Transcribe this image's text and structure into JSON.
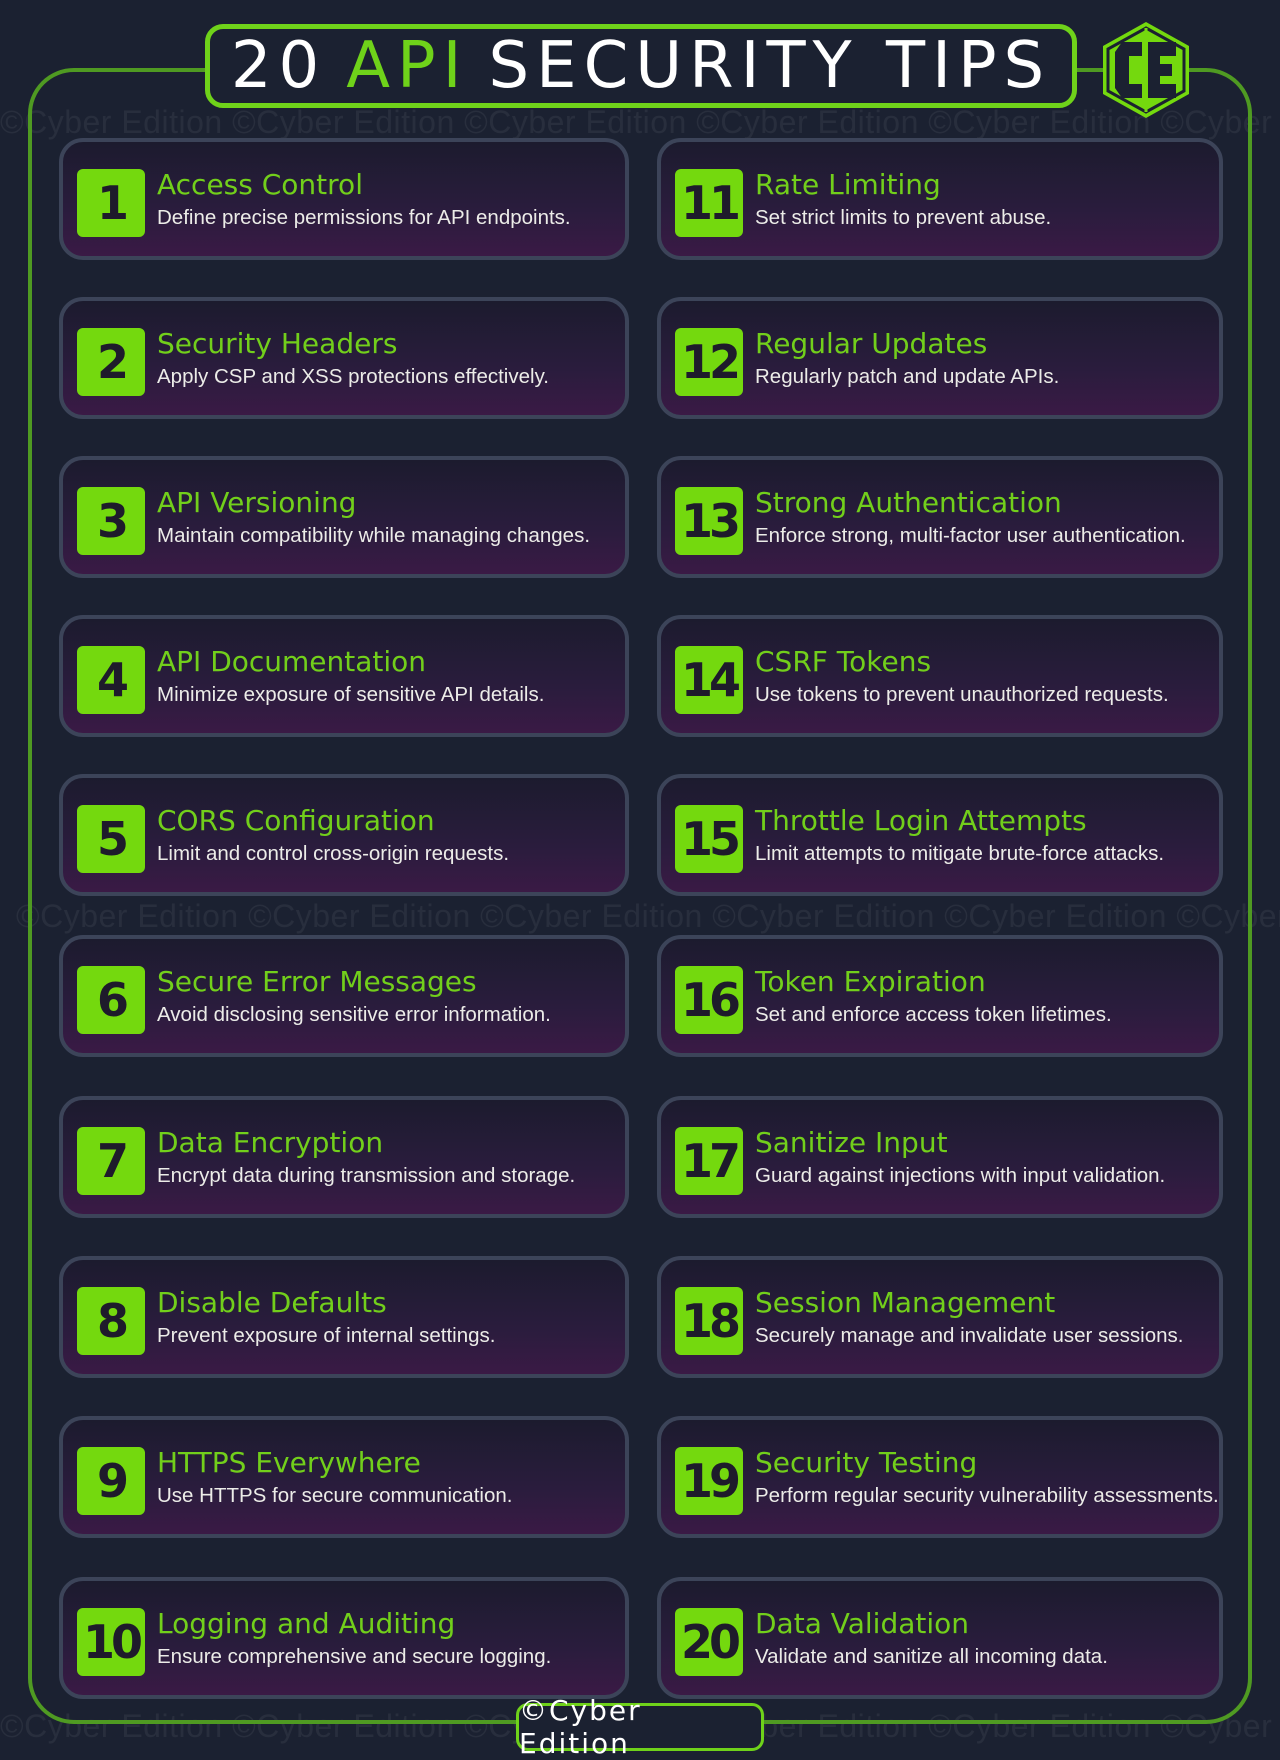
{
  "header": {
    "title_prefix": "20",
    "title_accent": "API",
    "title_suffix": "SECURITY TIPS",
    "logo_text": "CE"
  },
  "watermark": "©Cyber Edition  ©Cyber Edition  ©Cyber Edition  ©Cyber Edition  ©Cyber Edition  ©Cyber Edition",
  "colors": {
    "accent_green": "#74d90e",
    "title_green": "#72cf1b",
    "background": "#1b2131",
    "frame_green": "#4f9a22",
    "card_border": "#3c4459"
  },
  "tips": [
    {
      "num": "1",
      "title": "Access Control",
      "desc": "Define precise permissions for API endpoints."
    },
    {
      "num": "2",
      "title": "Security Headers",
      "desc": "Apply CSP and XSS protections effectively."
    },
    {
      "num": "3",
      "title": "API Versioning",
      "desc": "Maintain compatibility while managing changes."
    },
    {
      "num": "4",
      "title": "API Documentation",
      "desc": "Minimize exposure of sensitive API details."
    },
    {
      "num": "5",
      "title": "CORS Configuration",
      "desc": "Limit and control cross-origin requests."
    },
    {
      "num": "6",
      "title": "Secure Error Messages",
      "desc": "Avoid disclosing sensitive error information."
    },
    {
      "num": "7",
      "title": "Data Encryption",
      "desc": "Encrypt data during transmission and storage."
    },
    {
      "num": "8",
      "title": "Disable Defaults",
      "desc": "Prevent exposure of internal settings."
    },
    {
      "num": "9",
      "title": "HTTPS Everywhere",
      "desc": "Use HTTPS for secure communication."
    },
    {
      "num": "10",
      "title": "Logging and Auditing",
      "desc": "Ensure comprehensive and secure logging."
    },
    {
      "num": "11",
      "title": "Rate Limiting",
      "desc": "Set strict limits to prevent abuse."
    },
    {
      "num": "12",
      "title": "Regular Updates",
      "desc": "Regularly patch and update APIs."
    },
    {
      "num": "13",
      "title": "Strong Authentication",
      "desc": "Enforce strong, multi-factor user authentication."
    },
    {
      "num": "14",
      "title": "CSRF Tokens",
      "desc": "Use tokens to prevent unauthorized requests."
    },
    {
      "num": "15",
      "title": "Throttle Login Attempts",
      "desc": "Limit attempts to mitigate brute-force attacks."
    },
    {
      "num": "16",
      "title": "Token Expiration",
      "desc": "Set and enforce access token lifetimes."
    },
    {
      "num": "17",
      "title": "Sanitize Input",
      "desc": "Guard against injections with input validation."
    },
    {
      "num": "18",
      "title": "Session Management",
      "desc": "Securely manage and invalidate user sessions."
    },
    {
      "num": "19",
      "title": "Security Testing",
      "desc": "Perform regular security vulnerability assessments."
    },
    {
      "num": "20",
      "title": "Data Validation",
      "desc": "Validate and sanitize all incoming data."
    }
  ],
  "footer": {
    "label": "©Cyber Edition"
  }
}
